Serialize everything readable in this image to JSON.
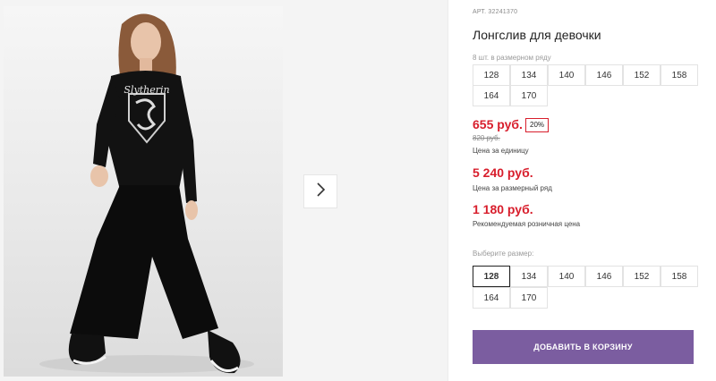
{
  "product": {
    "sku": "АРТ. 32241370",
    "title": "Лонгслив для девочки",
    "pack_caption": "8 шт. в размерном ряду",
    "pack_sizes": [
      "128",
      "134",
      "140",
      "146",
      "152",
      "158",
      "164",
      "170"
    ],
    "price": "655 руб.",
    "discount": "20%",
    "old_price": "820 руб.",
    "unit_price_label": "Цена за единицу",
    "pack_price": "5 240 руб.",
    "pack_price_label": "Цена за размерный ряд",
    "retail_price": "1 180 руб.",
    "retail_price_label": "Рекомендуемая розничная цена",
    "choose_size_caption": "Выберите размер:",
    "sizes": [
      "128",
      "134",
      "140",
      "146",
      "152",
      "158",
      "164",
      "170"
    ],
    "selected_size": "128",
    "add_to_cart_label": "ДОБАВИТЬ В КОРЗИНУ"
  },
  "gallery": {
    "shirt_print": "Slytherin",
    "next_icon": "chevron-right-icon"
  },
  "colors": {
    "price_red": "#d81e2c",
    "button_purple": "#7b5da0"
  }
}
